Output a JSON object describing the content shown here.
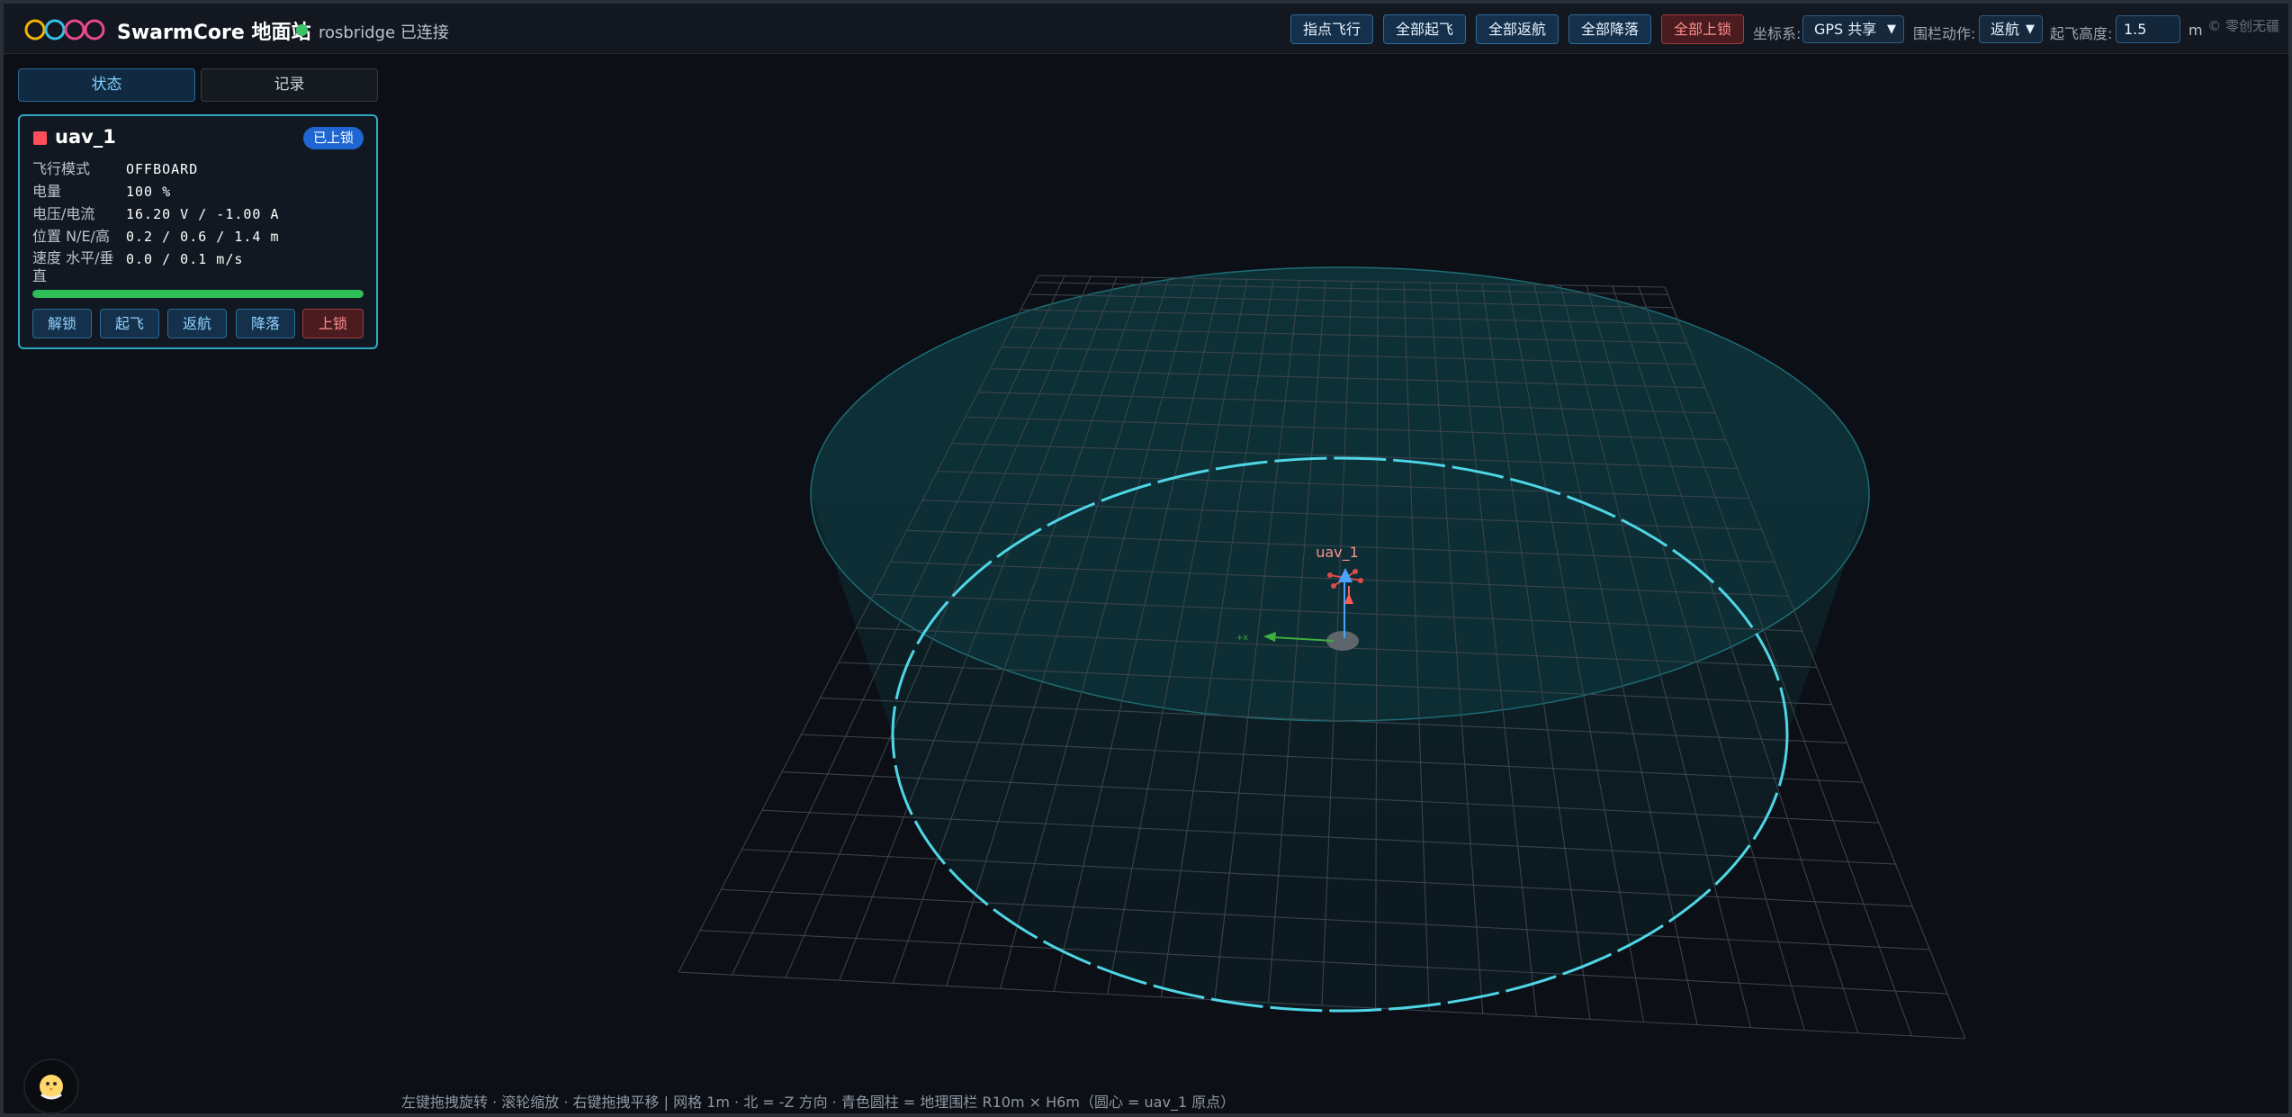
{
  "header": {
    "title": "SwarmCore 地面站",
    "connection": "rosbridge 已连接",
    "buttons": {
      "point_fly": "指点飞行",
      "all_takeoff": "全部起飞",
      "all_return": "全部返航",
      "all_land": "全部降落",
      "all_arm": "全部上锁"
    },
    "coord_label": "坐标系:",
    "coord_value": "GPS 共享",
    "fence_label": "围栏动作:",
    "fence_value": "返航",
    "alt_label": "起飞高度:",
    "alt_value": "1.5",
    "alt_unit": "m",
    "copyright": "© 零创无疆"
  },
  "tabs": {
    "status": "状态",
    "log": "记录"
  },
  "uav": {
    "name": "uav_1",
    "badge": "已上锁",
    "rows": [
      {
        "label": "飞行模式",
        "value": "OFFBOARD"
      },
      {
        "label": "电量",
        "value": "100 %"
      },
      {
        "label": "电压/电流",
        "value": "16.20 V / -1.00 A"
      },
      {
        "label": "位置 N/E/高",
        "value": "0.2 / 0.6 / 1.4 m"
      },
      {
        "label": "速度 水平/垂直",
        "value": "0.0 / 0.1 m/s"
      }
    ],
    "battery_fraction": 1.0,
    "buttons": {
      "arm": "解锁",
      "takeoff": "起飞",
      "return": "返航",
      "land": "降落",
      "lock": "上锁"
    }
  },
  "scene": {
    "drone_label": "uav_1",
    "axis_label": "+x"
  },
  "hint": "左键拖拽旋转 · 滚轮缩放 · 右键拖拽平移 | 网格 1m · 北 = -Z 方向 · 青色圆柱 = 地理围栏 R10m × H6m（圆心 = uav_1 原点）",
  "colors": {
    "accent": "#2ea6c0",
    "fence": "#4fd6e6",
    "drone": "#ff4d5a",
    "armed_badge": "#1f66d3",
    "battery": "#2fbf59"
  }
}
